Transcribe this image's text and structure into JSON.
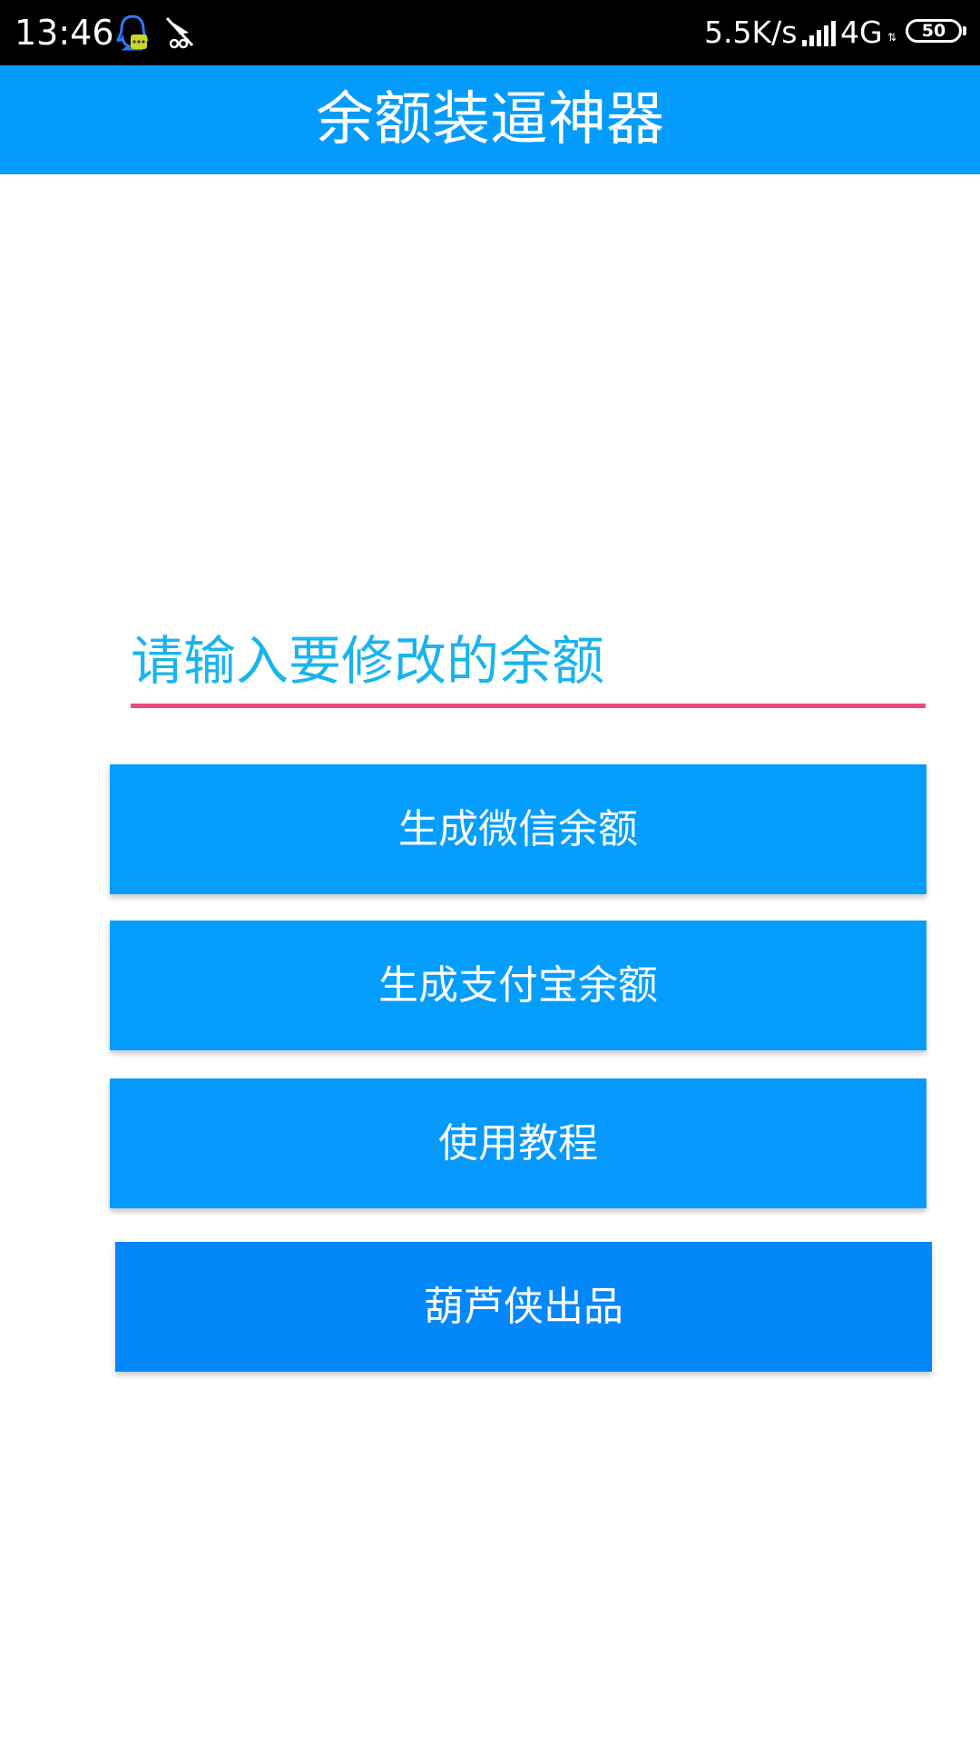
{
  "status_bar": {
    "time": "13:46",
    "net_speed": "5.5K/s",
    "network_type": "4G",
    "network_arrows": "⇅",
    "battery": "50",
    "icons": [
      "qq-icon",
      "send-icon",
      "signal-icon"
    ]
  },
  "app_bar": {
    "title": "余额装逼神器",
    "color": "#039cfd"
  },
  "form": {
    "amount_placeholder": "请输入要修改的余额",
    "amount_value": "",
    "underline_color": "#f04683",
    "text_color": "#19b4ee"
  },
  "buttons": {
    "wechat_label": "生成微信余额",
    "alipay_label": "生成支付宝余额",
    "tutorial_label": "使用教程",
    "credit_label": "葫芦侠出品"
  }
}
